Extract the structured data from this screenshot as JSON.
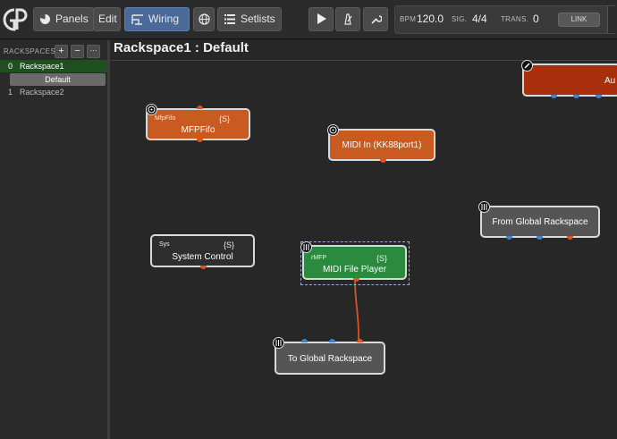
{
  "toolbar": {
    "panels_label": "Panels",
    "edit_label": "Edit",
    "wiring_label": "Wiring",
    "setlists_label": "Setlists"
  },
  "transport": {
    "bpm_label": "BPM",
    "bpm_value": "120.0",
    "sig_label": "SIG.",
    "sig_value": "4/4",
    "trans_label": "TRANS.",
    "trans_value": "0",
    "link_label": "LINK"
  },
  "sidebar": {
    "title": "RACKSPACES",
    "add": "+",
    "remove": "−",
    "more": "···",
    "rackspaces": [
      {
        "index": "0",
        "name": "Rackspace1",
        "selected": true
      },
      {
        "index": "1",
        "name": "Rackspace2",
        "selected": false
      }
    ],
    "variation": "Default"
  },
  "canvas": {
    "title": "Rackspace1 : Default"
  },
  "nodes": {
    "mfpfifo": {
      "small": "MfpFifo",
      "tag": "{S}",
      "name": "MFPFifo"
    },
    "midi_in": {
      "name": "MIDI In (KK88port1)"
    },
    "audio": {
      "name": "Au"
    },
    "from_global": {
      "name": "From Global Rackspace"
    },
    "system_control": {
      "small": "Sys",
      "tag": "{S}",
      "name": "System Control"
    },
    "midi_file_player": {
      "small": "rMFP",
      "tag": "{S}",
      "name": "MIDI File Player"
    },
    "to_global": {
      "name": "To Global Rackspace"
    }
  },
  "colors": {
    "accent_blue": "#4a6a9a",
    "node_orange": "#c95a20",
    "node_red": "#a82e0c",
    "node_green": "#2a8a3e",
    "node_gray": "#555555",
    "node_dark": "#2e2e2e",
    "midi_pin": "#d9541e",
    "audio_pin": "#3f84c9",
    "wire": "#d9541e"
  }
}
